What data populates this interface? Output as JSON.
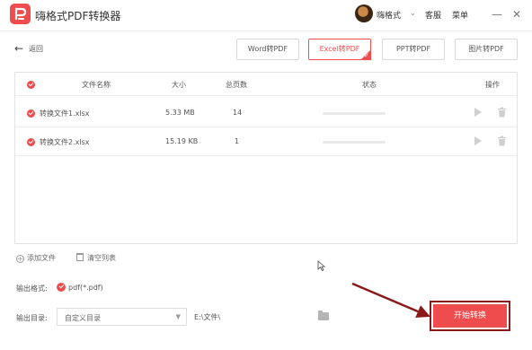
{
  "app": {
    "title": "嗨格式PDF转换器"
  },
  "header": {
    "user_name": "嗨格式",
    "user_chevron": "⌄",
    "service": "客服",
    "menu": "菜单",
    "minimize": "—",
    "close": "✕"
  },
  "nav": {
    "back_label": "返回"
  },
  "tabs": [
    {
      "label": "Word转PDF",
      "active": false
    },
    {
      "label": "Excel转PDF",
      "active": true
    },
    {
      "label": "PPT转PDF",
      "active": false
    },
    {
      "label": "图片转PDF",
      "active": false
    }
  ],
  "table": {
    "headers": {
      "name": "文件名称",
      "size": "大小",
      "pages": "总页数",
      "status": "状态",
      "action": "操作"
    },
    "rows": [
      {
        "name": "转换文件1.xlsx",
        "size": "5.33 MB",
        "pages": "14",
        "progress": 0
      },
      {
        "name": "转换文件2.xlsx",
        "size": "15.19 KB",
        "pages": "1",
        "progress": 0
      }
    ]
  },
  "list_actions": {
    "add_file": "添加文件",
    "clear_list": "清空列表"
  },
  "output": {
    "format_label": "输出格式:",
    "format_value": "pdf(*.pdf)",
    "dir_label": "输出目录:",
    "dir_option": "自定义目录",
    "dir_path": "E:\\文件\\"
  },
  "start_button": "开始转换",
  "colors": {
    "accent": "#ef4d4d",
    "annotation": "#8a1a1a"
  }
}
